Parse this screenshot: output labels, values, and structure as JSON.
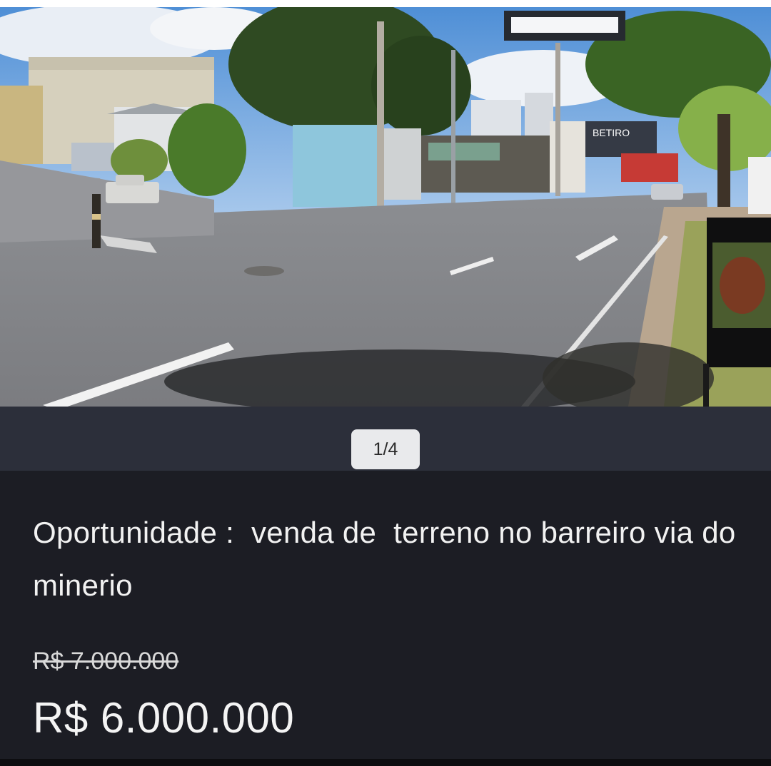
{
  "listing": {
    "title": "Oportunidade :  venda de  terreno no barreiro via do minerio",
    "old_price": "R$ 7.000.000",
    "price": "R$ 6.000.000"
  },
  "gallery": {
    "current": 1,
    "total": 4,
    "counter_label": "1/4",
    "photo_sign_text": "BETIRO"
  },
  "colors": {
    "background": "#1c1d24",
    "pager_band": "#2c2f3a",
    "pager_badge": "#e9eaec",
    "text": "#f2f2f2"
  }
}
